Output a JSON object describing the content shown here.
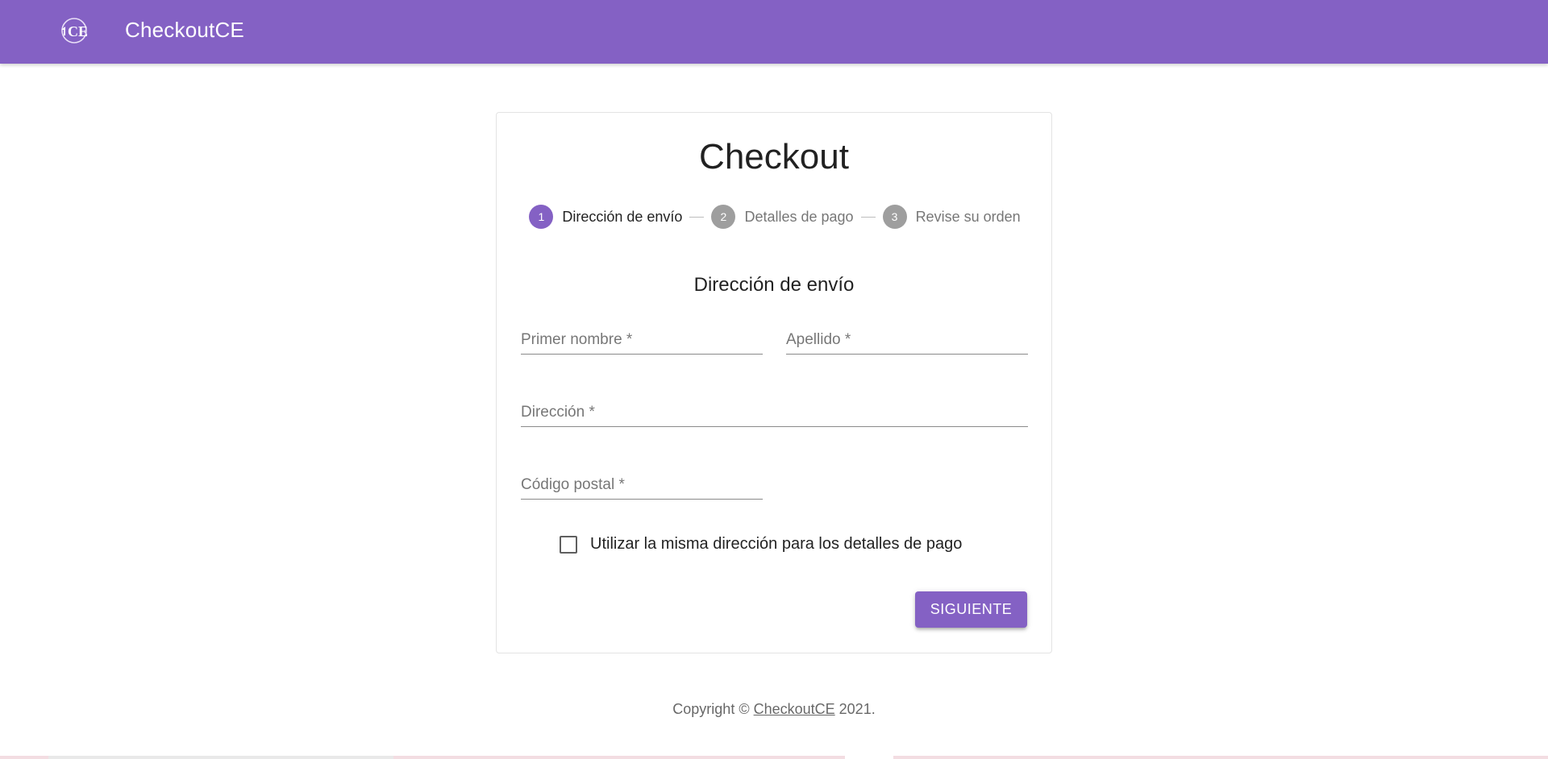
{
  "header": {
    "title": "CheckoutCE",
    "logo_text": "CE",
    "background": "#8461c4"
  },
  "card": {
    "title": "Checkout",
    "steps": [
      {
        "number": "1",
        "label": "Dirección de envío",
        "state": "active"
      },
      {
        "number": "2",
        "label": "Detalles de pago",
        "state": "inactive"
      },
      {
        "number": "3",
        "label": "Revise su orden",
        "state": "inactive"
      }
    ],
    "section_title": "Dirección de envío",
    "fields": {
      "first_name": {
        "placeholder": "Primer nombre *",
        "value": ""
      },
      "last_name": {
        "placeholder": "Apellido *",
        "value": ""
      },
      "address": {
        "placeholder": "Dirección *",
        "value": ""
      },
      "postal_code": {
        "placeholder": "Código postal *",
        "value": ""
      }
    },
    "checkbox": {
      "label": "Utilizar la misma dirección para los detalles de pago",
      "checked": false
    },
    "next_button": "SIGUIENTE"
  },
  "footer": {
    "prefix": "Copyright © ",
    "link": "CheckoutCE",
    "suffix": " 2021."
  },
  "colors": {
    "primary": "#8461c4",
    "step_inactive": "#9e9e9e"
  }
}
